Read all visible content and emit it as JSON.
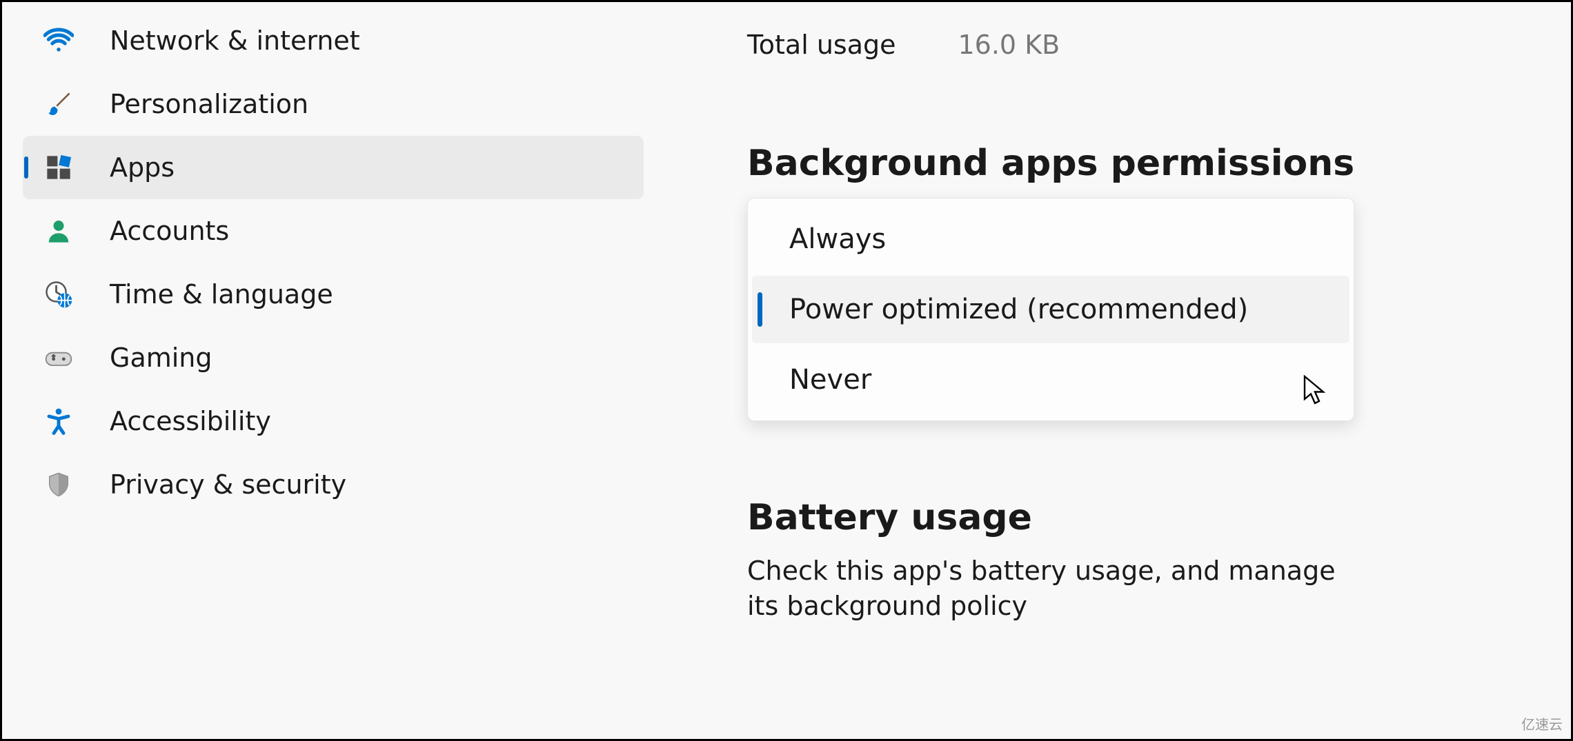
{
  "sidebar": {
    "items": [
      {
        "label": "Network & internet",
        "icon": "wifi-icon"
      },
      {
        "label": "Personalization",
        "icon": "paintbrush-icon"
      },
      {
        "label": "Apps",
        "icon": "apps-icon",
        "selected": true
      },
      {
        "label": "Accounts",
        "icon": "person-icon"
      },
      {
        "label": "Time & language",
        "icon": "clock-globe-icon"
      },
      {
        "label": "Gaming",
        "icon": "gamepad-icon"
      },
      {
        "label": "Accessibility",
        "icon": "accessibility-icon"
      },
      {
        "label": "Privacy & security",
        "icon": "shield-icon"
      }
    ]
  },
  "main": {
    "usage": {
      "label": "Total usage",
      "value": "16.0 KB"
    },
    "background_permissions": {
      "title": "Background apps permissions",
      "options": [
        {
          "label": "Always"
        },
        {
          "label": "Power optimized (recommended)",
          "selected": true
        },
        {
          "label": "Never"
        }
      ]
    },
    "battery": {
      "title": "Battery usage",
      "description": "Check this app's battery usage, and manage its background policy"
    }
  },
  "watermark": "亿速云"
}
